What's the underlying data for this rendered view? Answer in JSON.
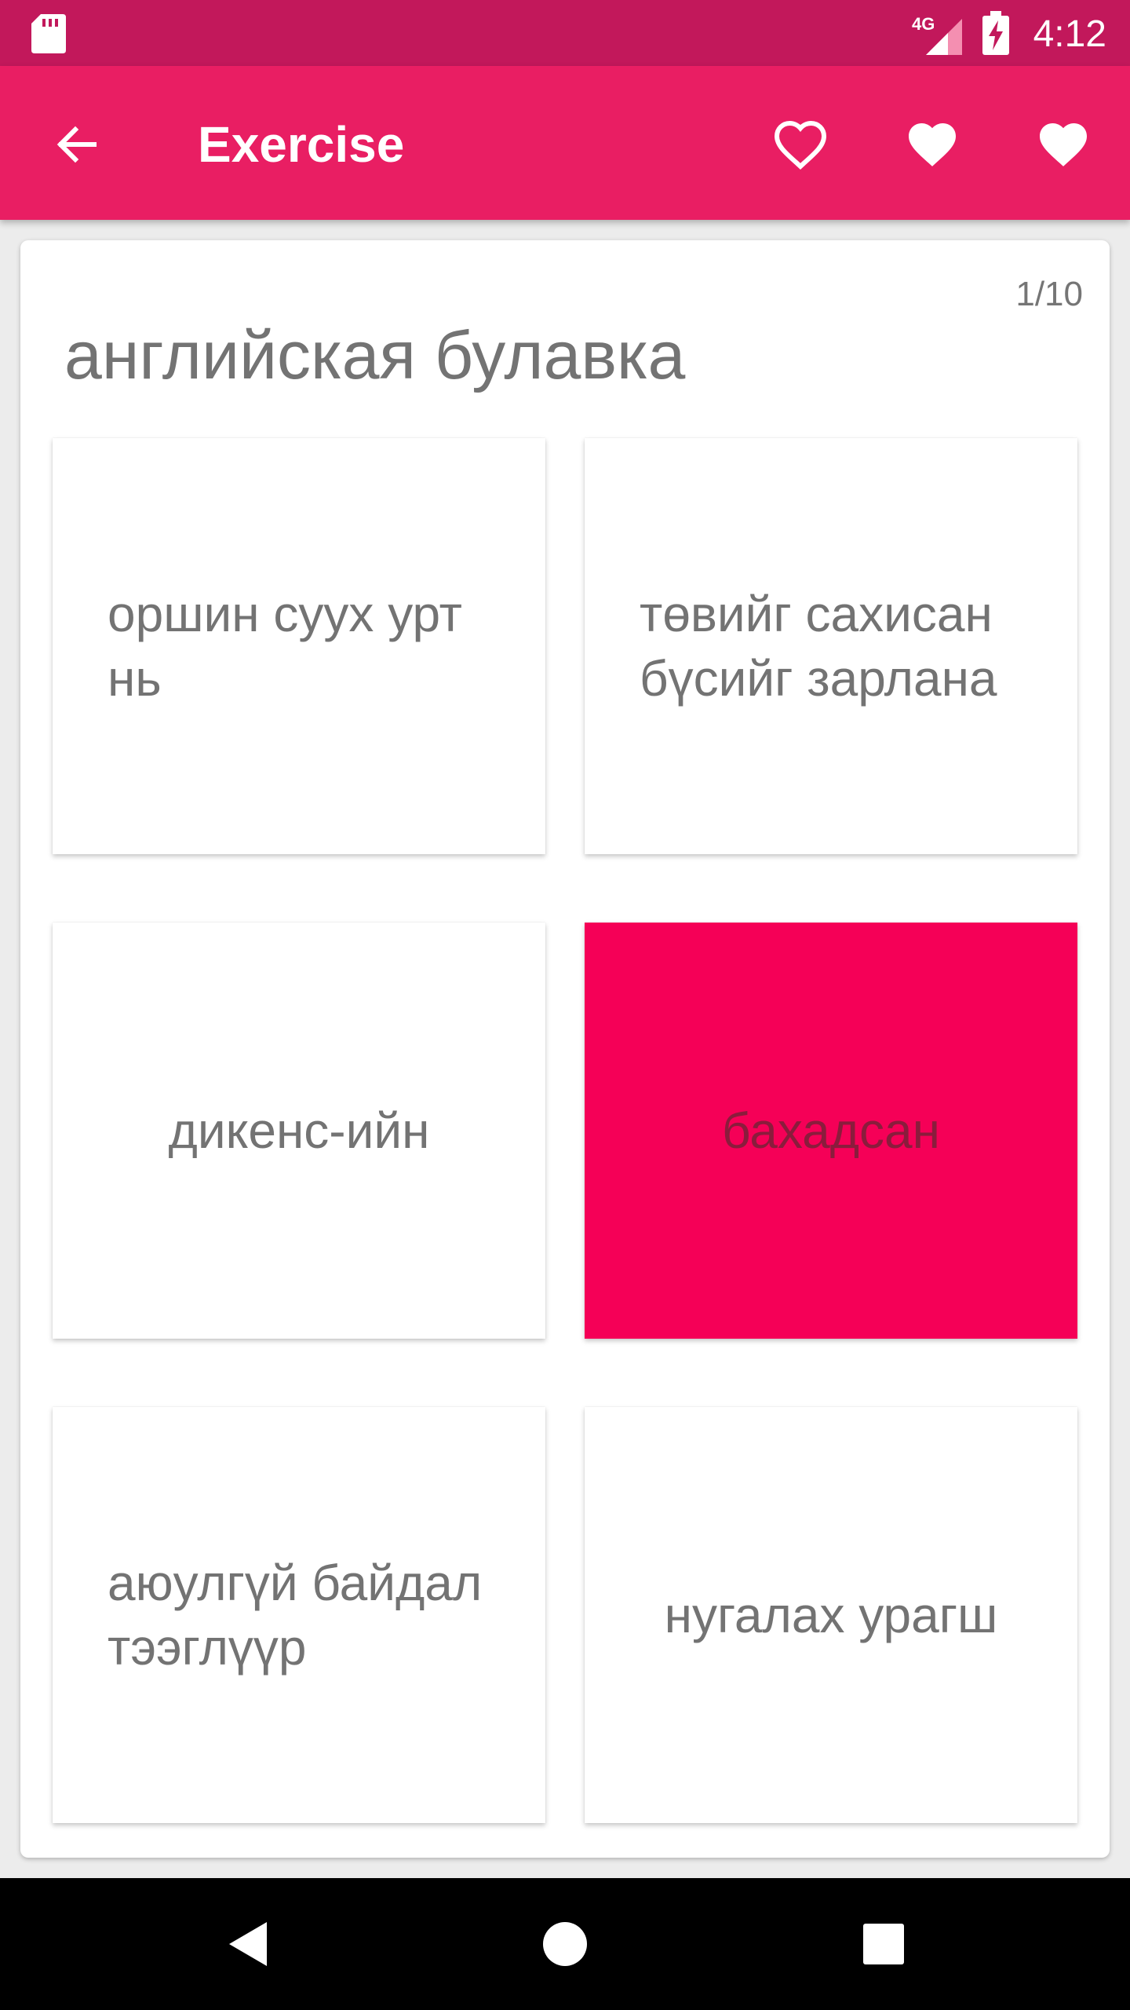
{
  "status_bar": {
    "network": "4G",
    "time": "4:12",
    "icons": [
      "sd-card-icon",
      "signal-icon",
      "battery-charging-icon"
    ]
  },
  "app_bar": {
    "title": "Exercise",
    "back_icon": "arrow-left-icon",
    "actions": [
      "heart-outline-icon",
      "heart-filled-icon",
      "heart-filled-icon"
    ]
  },
  "exercise": {
    "progress": "1/10",
    "question": "английская булавка",
    "options": [
      {
        "label": "оршин суух урт нь",
        "selected": false
      },
      {
        "label": "төвийг сахисан бүсийг зарлана",
        "selected": false
      },
      {
        "label": "дикенс-ийн",
        "selected": false
      },
      {
        "label": "бахадсан",
        "selected": true
      },
      {
        "label": "аюулгүй байдал тээглүүр",
        "selected": false
      },
      {
        "label": "нугалах урагш",
        "selected": false
      }
    ]
  },
  "nav_bar": {
    "buttons": [
      "back-triangle-icon",
      "home-circle-icon",
      "recents-square-icon"
    ]
  },
  "colors": {
    "status_bar": "#c2185b",
    "app_bar": "#e91e63",
    "selected_option": "#f50057",
    "option_text": "#737373"
  }
}
